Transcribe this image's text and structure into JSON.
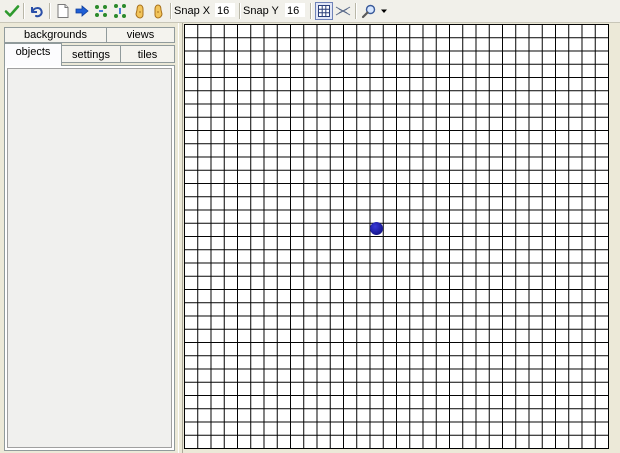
{
  "toolbar": {
    "icons": [
      "check-icon",
      "undo-icon",
      "new-page-icon",
      "arrow-right-icon",
      "move-horizontal-icon",
      "move-vertical-icon",
      "shift-left-icon",
      "shift-right-icon",
      "grid-icon",
      "isometric-grid-icon",
      "zoom-icon",
      "dropdown-arrow-icon"
    ],
    "snap_x_label": "Snap X",
    "snap_x_value": "16",
    "snap_y_label": "Snap Y",
    "snap_y_value": "16",
    "colors": {
      "check": "#2e9a2e",
      "undo": "#2a4fa8",
      "arrows": "#1f5fd6",
      "move": "#2a8a2a",
      "hand": "#e0a020"
    }
  },
  "tabs": {
    "top_row": [
      "backgrounds",
      "views"
    ],
    "bottom_row": [
      "objects",
      "settings",
      "tiles"
    ],
    "active": "objects"
  },
  "room": {
    "instance_color": "#1a1a9a"
  }
}
